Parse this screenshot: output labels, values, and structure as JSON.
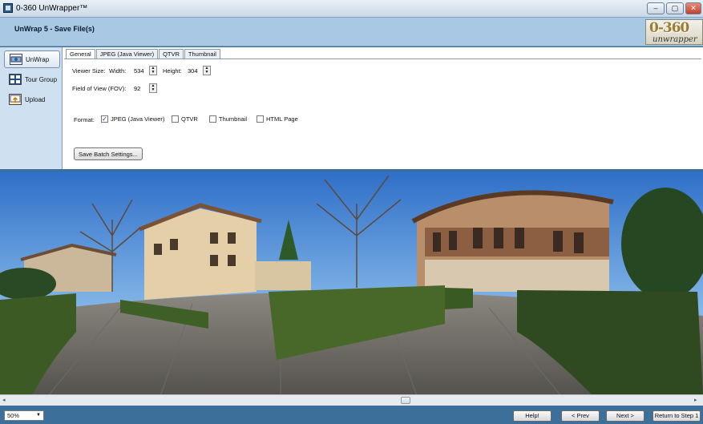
{
  "window": {
    "title": "0-360 UnWrapper™",
    "minimize_label": "–",
    "maximize_label": "▢",
    "close_label": "✕"
  },
  "header": {
    "step_title": "UnWrap 5 - Save File(s)",
    "logo_main": "0-360",
    "logo_sub": "unwrapper"
  },
  "sidebar": {
    "items": [
      {
        "label": "UnWrap",
        "icon": "unwrap-icon",
        "active": true
      },
      {
        "label": "Tour Group",
        "icon": "tour-group-icon",
        "active": false
      },
      {
        "label": "Upload",
        "icon": "upload-icon",
        "active": false
      }
    ]
  },
  "tabs": [
    {
      "label": "General",
      "active": true
    },
    {
      "label": "JPEG (Java Viewer)",
      "active": false
    },
    {
      "label": "QTVR",
      "active": false
    },
    {
      "label": "Thumbnail",
      "active": false
    }
  ],
  "general": {
    "viewer_size_label": "Viewer Size:",
    "width_label": "Width:",
    "width_value": "534",
    "height_label": "Height:",
    "height_value": "304",
    "fov_label": "Field of View (FOV):",
    "fov_value": "92",
    "format_label": "Format:",
    "formats": [
      {
        "label": "JPEG (Java Viewer)",
        "checked": true
      },
      {
        "label": "QTVR",
        "checked": false
      },
      {
        "label": "Thumbnail",
        "checked": false
      },
      {
        "label": "HTML Page",
        "checked": false
      }
    ],
    "save_batch_label": "Save Batch Settings..."
  },
  "viewer": {
    "scroll_left_label": "◂",
    "scroll_right_label": "▸"
  },
  "bottom": {
    "zoom_value": "50%",
    "help_label": "Help!",
    "prev_label": "< Prev",
    "next_label": "Next >",
    "return_label": "Return to Step 1"
  },
  "colors": {
    "accent": "#3c709b",
    "header": "#a8c8e4",
    "sidebar": "#cfe0f0"
  }
}
